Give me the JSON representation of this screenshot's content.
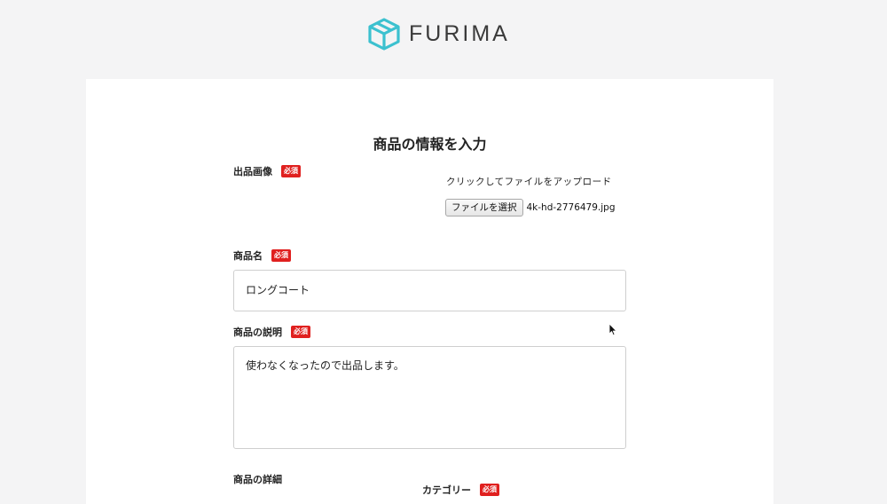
{
  "header": {
    "logo_text": "FURIMA",
    "brand_color": "#3cc1cf"
  },
  "form": {
    "title": "商品の情報を入力",
    "required_badge": "必須",
    "required_color": "#e0201f",
    "image": {
      "label": "出品画像",
      "upload_text": "クリックしてファイルをアップロード",
      "file_button_label": "ファイルを選択",
      "file_name": "4k-hd-2776479.jpg"
    },
    "name": {
      "label": "商品名",
      "value": "ロングコート"
    },
    "description": {
      "label": "商品の説明",
      "value": "使わなくなったので出品します。"
    },
    "details": {
      "label": "商品の詳細",
      "category_label": "カテゴリー"
    }
  }
}
